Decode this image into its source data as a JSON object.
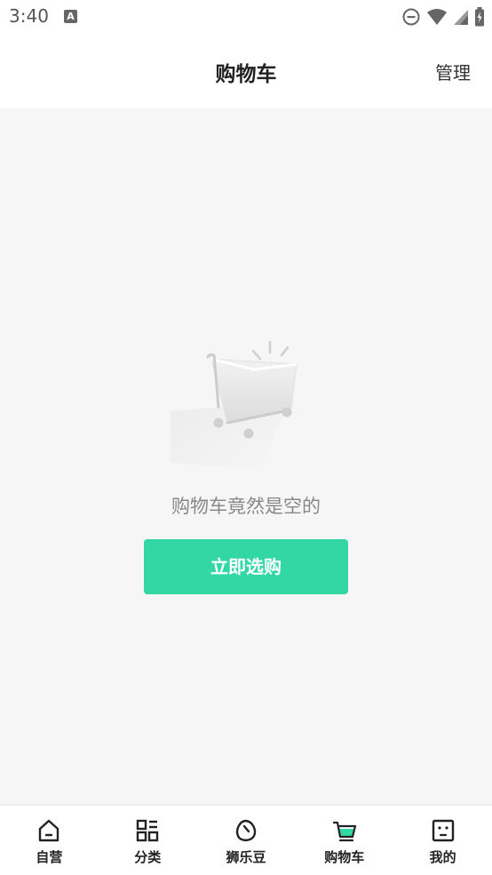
{
  "status_bar": {
    "time": "3:40",
    "icons": [
      "a-notification-icon",
      "dnd-icon",
      "wifi-icon",
      "signal-icon",
      "battery-icon"
    ]
  },
  "header": {
    "title": "购物车",
    "manage_label": "管理"
  },
  "empty_state": {
    "message": "购物车竟然是空的",
    "button_label": "立即选购",
    "accent_color": "#33d7a4"
  },
  "bottom_nav": {
    "items": [
      {
        "label": "自营",
        "icon": "home-icon"
      },
      {
        "label": "分类",
        "icon": "category-icon"
      },
      {
        "label": "狮乐豆",
        "icon": "bean-icon"
      },
      {
        "label": "购物车",
        "icon": "cart-icon",
        "active": true
      },
      {
        "label": "我的",
        "icon": "profile-icon"
      }
    ]
  }
}
